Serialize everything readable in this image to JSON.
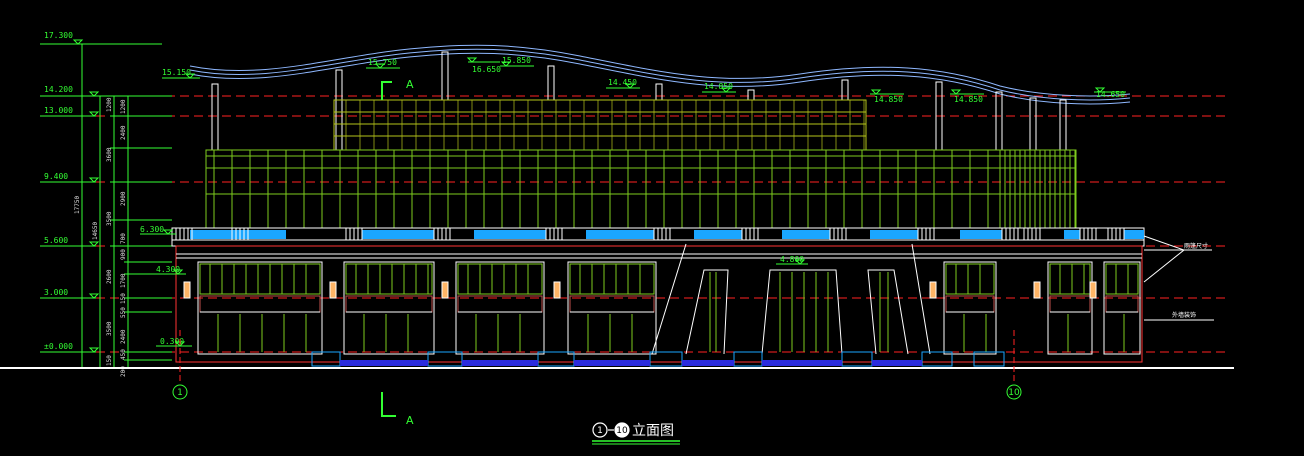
{
  "drawing": {
    "title_left_axis": "1",
    "title_right_axis": "10",
    "title_text": "立面图"
  },
  "axes": [
    {
      "label": "1"
    },
    {
      "label": "10"
    }
  ],
  "levels_left": [
    {
      "label": "17.300",
      "value": 17.3
    },
    {
      "label": "14.200",
      "value": 14.2
    },
    {
      "label": "13.000",
      "value": 13.0
    },
    {
      "label": "9.400",
      "value": 9.4
    },
    {
      "label": "5.600",
      "value": 5.6
    },
    {
      "label": "3.000",
      "value": 3.0
    },
    {
      "label": "±0.000",
      "value": 0.0
    }
  ],
  "levels_roof": [
    {
      "label": "15.150"
    },
    {
      "label": "15.750"
    },
    {
      "label": "16.650"
    },
    {
      "label": "15.850"
    },
    {
      "label": "14.450"
    },
    {
      "label": "14.850"
    },
    {
      "label": "14.850"
    },
    {
      "label": "14.850"
    },
    {
      "label": "14.650"
    }
  ],
  "levels_inner": [
    {
      "label": "6.300"
    },
    {
      "label": "4.300"
    },
    {
      "label": "0.300"
    },
    {
      "label": "4.800"
    }
  ],
  "dimensions": {
    "overall": "17750",
    "sub": "14650",
    "col2": [
      "1200",
      "3600",
      "3500",
      "2600",
      "3500",
      "2400",
      "150"
    ],
    "col3": [
      "1200",
      "2400",
      "2900",
      "700",
      "900",
      "1700",
      "150",
      "550",
      "2400",
      "450",
      "300",
      "200"
    ]
  },
  "notes": {
    "right_top": "雨篷尺寸",
    "right_mid": "外墙装饰"
  },
  "section_mark": {
    "label": "A"
  },
  "colors": {
    "background": "#000000",
    "level_text": "#33ff33",
    "datum_line": "#ff2222",
    "facade_green": "#7ecb1e",
    "glass_blue": "#1aa6ff",
    "roof_blue": "#8fb8ff",
    "column": "#ffffff"
  }
}
